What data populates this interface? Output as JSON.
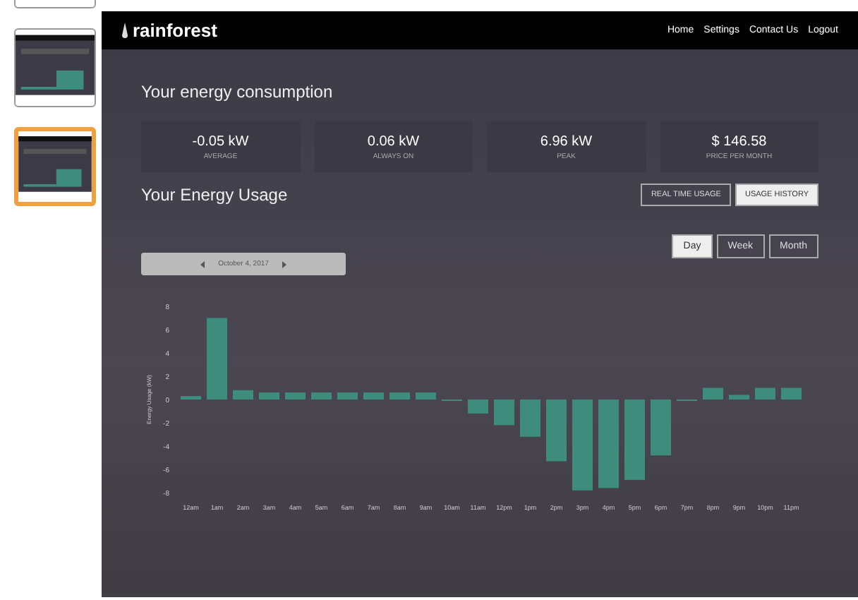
{
  "thumbnails": [
    {
      "selected": false
    },
    {
      "selected": false,
      "kind": "picture"
    },
    {
      "selected": true,
      "kind": "picture"
    }
  ],
  "header": {
    "logo": "rainforest",
    "nav": [
      "Home",
      "Settings",
      "Contact Us",
      "Logout"
    ]
  },
  "consumption": {
    "title": "Your energy consumption",
    "stats": [
      {
        "value": "-0.05 kW",
        "label": "AVERAGE"
      },
      {
        "value": "0.06 kW",
        "label": "ALWAYS ON"
      },
      {
        "value": "6.96 kW",
        "label": "PEAK"
      },
      {
        "value": "$ 146.58",
        "label": "PRICE PER MONTH"
      }
    ]
  },
  "usage": {
    "title": "Your Energy Usage",
    "modes": [
      {
        "label": "REAL TIME USAGE",
        "selected": false
      },
      {
        "label": "USAGE HISTORY",
        "selected": true
      }
    ],
    "periods": [
      {
        "label": "Day",
        "selected": true
      },
      {
        "label": "Week",
        "selected": false
      },
      {
        "label": "Month",
        "selected": false
      }
    ],
    "date": "October 4, 2017",
    "chart_data": {
      "type": "bar",
      "ylabel": "Energy Usage (kW)",
      "categories": [
        "12am",
        "1am",
        "2am",
        "3am",
        "4am",
        "5am",
        "6am",
        "7am",
        "8am",
        "9am",
        "10am",
        "11am",
        "12pm",
        "1pm",
        "2pm",
        "3pm",
        "4pm",
        "5pm",
        "6pm",
        "7pm",
        "8pm",
        "9pm",
        "10pm",
        "11pm"
      ],
      "series": [
        {
          "color": "#3d8c7c",
          "values": [
            0.3,
            7,
            0.8,
            0.6,
            0.6,
            0.6,
            0.6,
            0.6,
            0.6,
            0.6,
            -0.1,
            -1.2,
            -2.2,
            -3.2,
            -5.3,
            -7.8,
            -7.6,
            -6.9,
            -4.8,
            -0.1,
            1.0,
            0.4,
            1.0,
            1.0
          ]
        }
      ],
      "ylim": [
        -8,
        8
      ],
      "yticks": [
        8,
        6,
        4,
        2,
        0,
        -2,
        -4,
        -6,
        -8
      ]
    }
  }
}
